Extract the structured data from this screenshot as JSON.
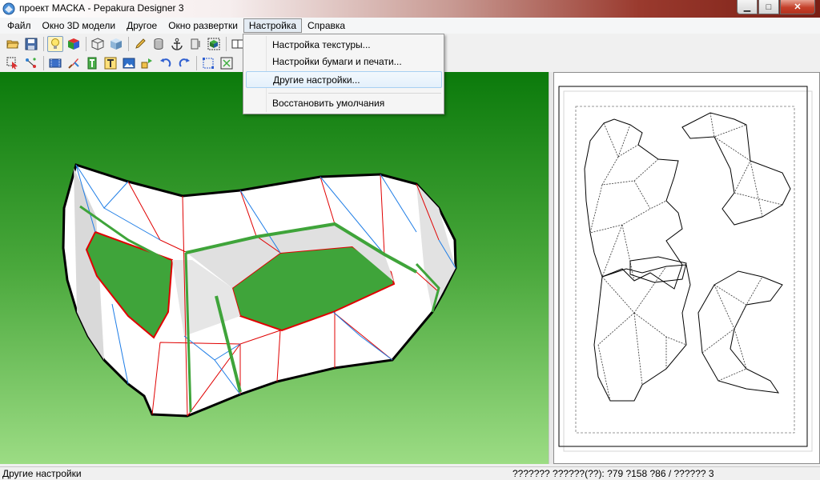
{
  "window": {
    "title": "проект МАСКА - Pepakura Designer 3",
    "controls": {
      "minimize": "▁",
      "maximize": "□",
      "close": "✕"
    }
  },
  "menubar": {
    "items": [
      {
        "label": "Файл"
      },
      {
        "label": "Окно 3D модели"
      },
      {
        "label": "Другое"
      },
      {
        "label": "Окно развертки"
      },
      {
        "label": "Настройка",
        "active": true
      },
      {
        "label": "Справка"
      }
    ]
  },
  "dropdown": {
    "items": [
      {
        "label": "Настройка текстуры..."
      },
      {
        "label": "Настройки бумаги и печати..."
      },
      {
        "label": "Другие настройки...",
        "highlighted": true
      },
      {
        "label": "Восстановить умолчания"
      }
    ]
  },
  "statusbar": {
    "left": "Другие настройки",
    "right": "??????? ??????(??): ?79 ?158 ?86 / ?????? 3"
  },
  "colors": {
    "bg_top": "#0b7a0b",
    "bg_bottom": "#9cdc84",
    "mountain_fold": "#e00000",
    "valley_fold": "#1e7de6",
    "mask_edge": "#000000"
  },
  "icons": {
    "toolbar1": [
      "open-folder-icon",
      "save-icon",
      "lightbulb-icon",
      "color-cube-icon",
      "wire-cube-icon",
      "shaded-cube-icon",
      "pencil-icon",
      "cylinder-icon",
      "anchor-icon",
      "flat-panel-icon",
      "join-cube-icon",
      "paper-layout-icon"
    ],
    "toolbar2": [
      "select-arrow-icon",
      "node-edit-icon",
      "film-icon",
      "brush-icon",
      "text-column-icon",
      "text-icon",
      "image-icon",
      "move-parts-icon",
      "rotate-left-icon",
      "rotate-right-icon",
      "select-frame-icon",
      "zoom-fit-icon"
    ]
  }
}
